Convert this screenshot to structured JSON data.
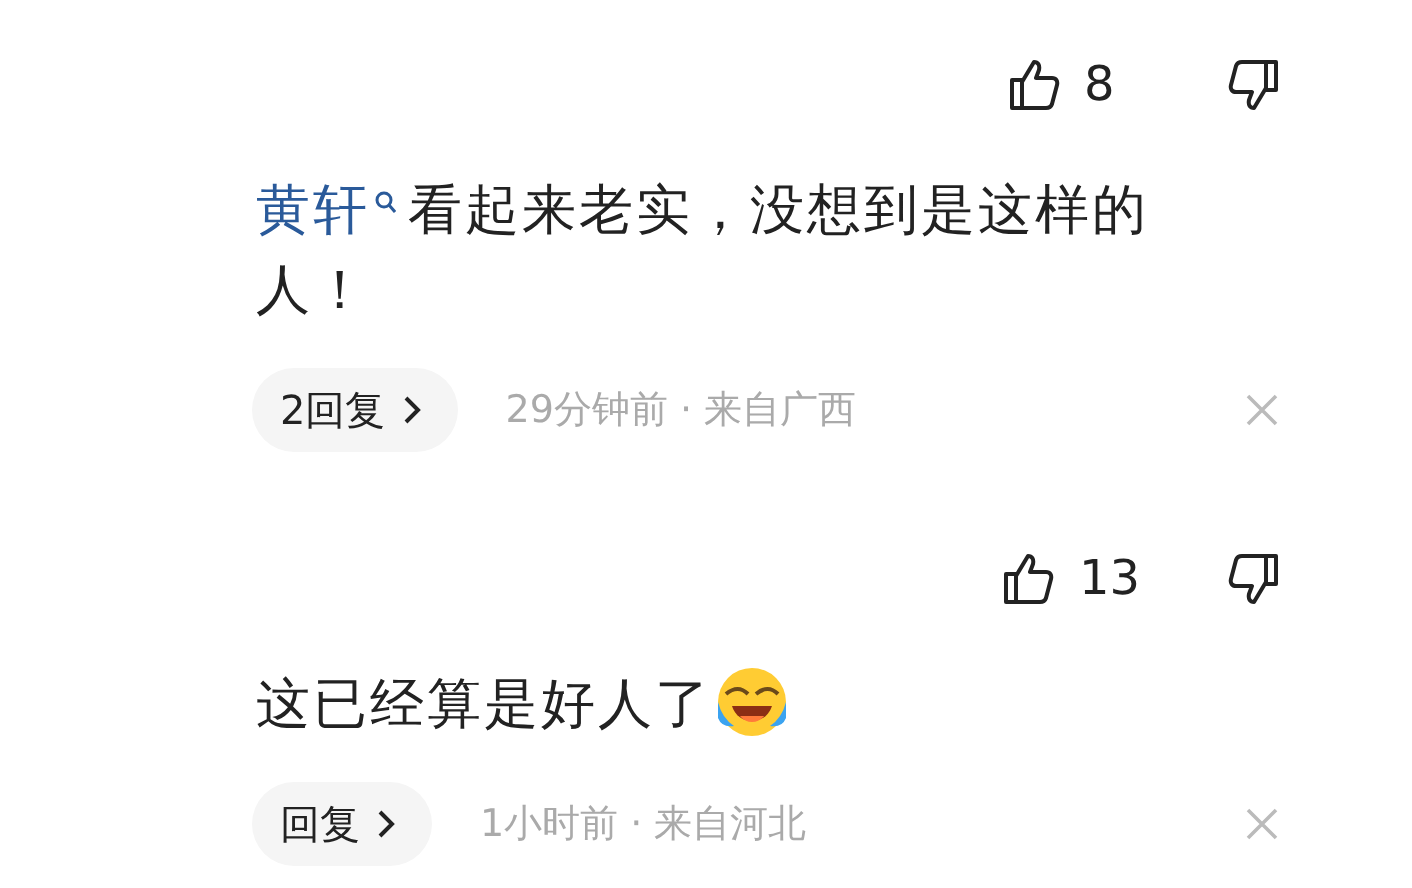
{
  "items": [
    {
      "kind": "votes",
      "likes": "8"
    },
    {
      "kind": "comment",
      "author": "黄轩",
      "text": "看起来老实，没想到是这样的人！",
      "reply": "2回复",
      "meta": "29分钟前 · 来自广西"
    },
    {
      "kind": "votes",
      "likes": "13"
    },
    {
      "kind": "comment",
      "text": "这已经算是好人了",
      "emoji": true,
      "reply": "回复",
      "meta": "1小时前 · 来自河北"
    }
  ]
}
